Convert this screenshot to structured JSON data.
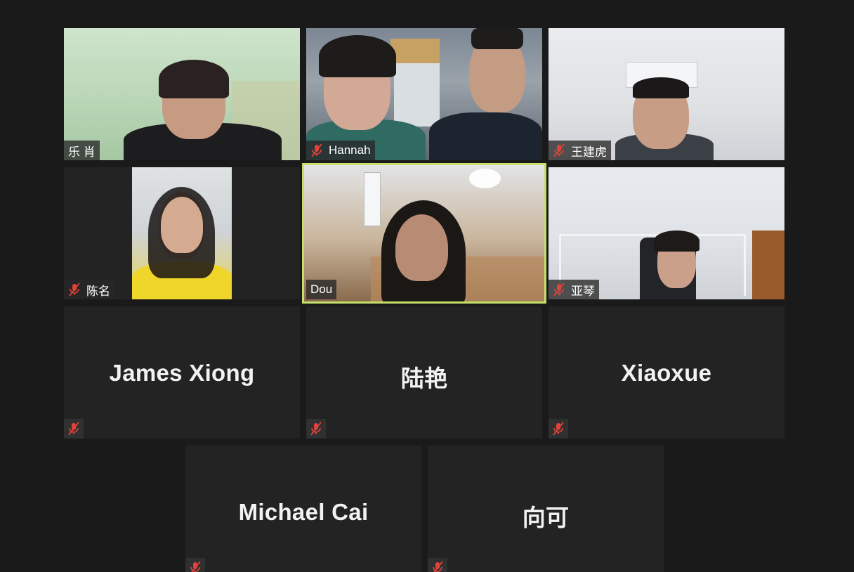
{
  "participants_video": [
    {
      "name": "乐 肖",
      "muted": false
    },
    {
      "name": "Hannah",
      "muted": true
    },
    {
      "name": "王建虎",
      "muted": true
    },
    {
      "name": "陈名",
      "muted": true
    },
    {
      "name": "Dou",
      "muted": false,
      "active_speaker": true
    },
    {
      "name": "亚琴",
      "muted": true
    }
  ],
  "participants_no_video": [
    {
      "name": "James Xiong",
      "muted": true
    },
    {
      "name": "陆艳",
      "muted": true
    },
    {
      "name": "Xiaoxue",
      "muted": true
    },
    {
      "name": "Michael Cai",
      "muted": true
    },
    {
      "name": "向可",
      "muted": true
    }
  ],
  "colors": {
    "background": "#1a1a1a",
    "tile": "#232323",
    "active_speaker_border": "#c4e06a",
    "muted_icon": "#e0433a"
  },
  "icons": {
    "muted": "microphone-muted-icon"
  }
}
